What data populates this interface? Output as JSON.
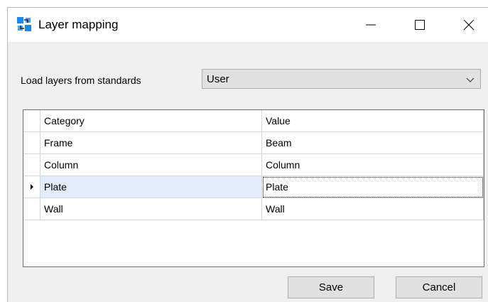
{
  "window": {
    "title": "Layer mapping",
    "icon": "layer-mapping-app-icon"
  },
  "titlebar_buttons": {
    "minimize": "minimize-icon",
    "maximize": "maximize-icon",
    "close": "close-icon"
  },
  "standards": {
    "label": "Load layers from standards",
    "selected": "User"
  },
  "grid": {
    "headers": [
      "Category",
      "Value"
    ],
    "rows": [
      {
        "category": "Frame",
        "value": "Beam"
      },
      {
        "category": "Column",
        "value": "Column"
      },
      {
        "category": "Plate",
        "value": "Plate",
        "selected": true
      },
      {
        "category": "Wall",
        "value": "Wall"
      }
    ]
  },
  "buttons": {
    "save": "Save",
    "cancel": "Cancel"
  },
  "colors": {
    "window_bg": "#f0f0f0",
    "selected_row": "#e2ecfa",
    "icon_blue": "#1e88e5"
  }
}
